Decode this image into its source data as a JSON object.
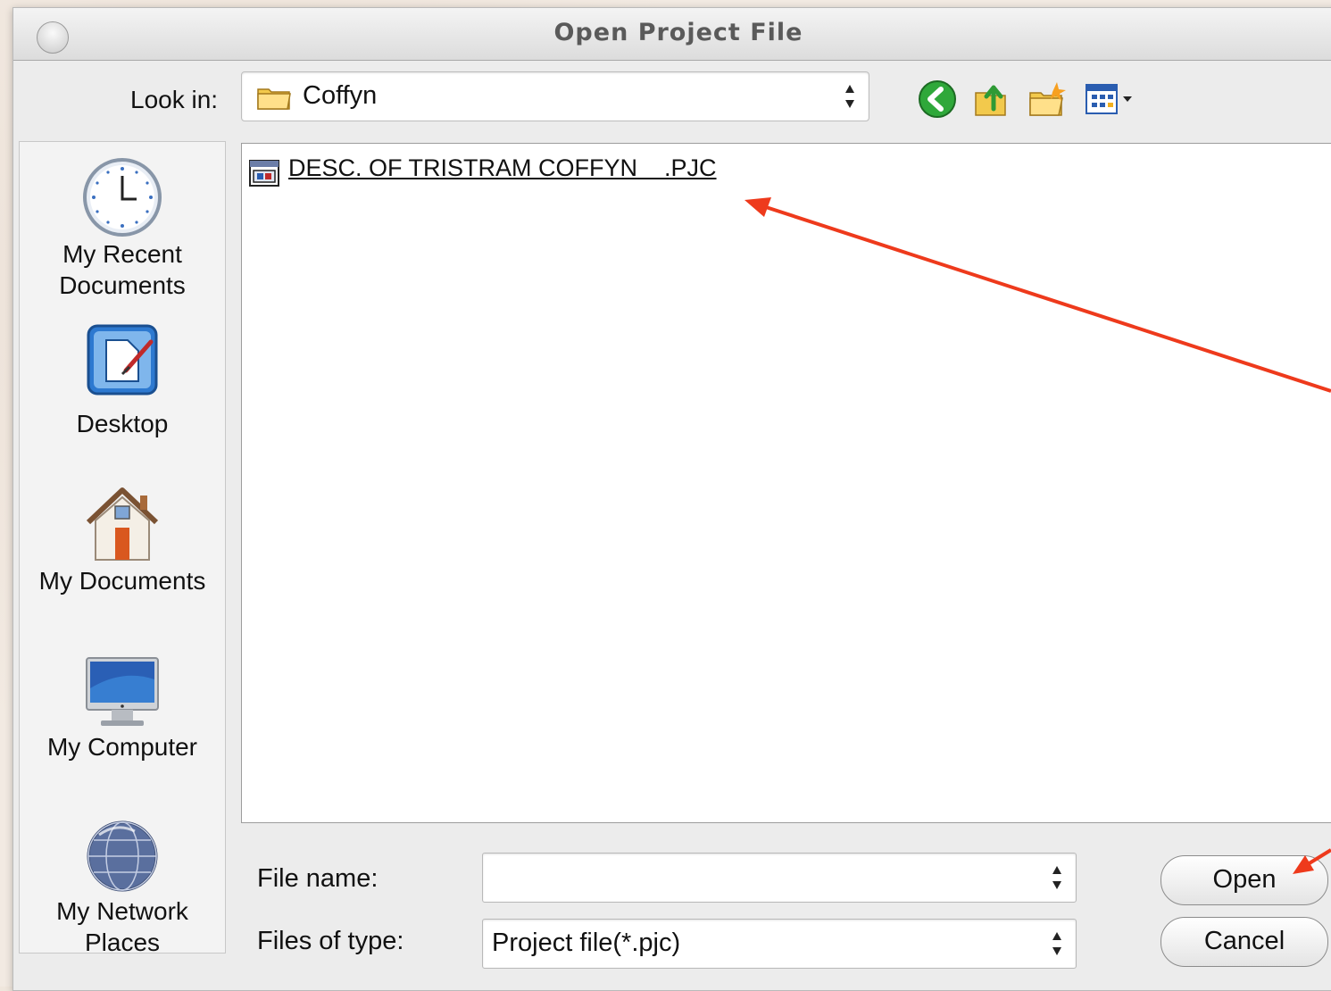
{
  "dialog": {
    "title": "Open Project File"
  },
  "look_in": {
    "label": "Look in:",
    "value": "Coffyn"
  },
  "toolbar": {
    "icons": [
      "back-icon",
      "up-folder-icon",
      "new-folder-icon",
      "view-menu-icon"
    ]
  },
  "places": [
    {
      "label": "My Recent Documents",
      "icon": "clock-icon"
    },
    {
      "label": "Desktop",
      "icon": "desktop-icon"
    },
    {
      "label": "My Documents",
      "icon": "house-icon"
    },
    {
      "label": "My Computer",
      "icon": "monitor-icon"
    },
    {
      "label": "My Network Places",
      "icon": "globe-icon"
    }
  ],
  "files": [
    {
      "name": "DESC. OF TRISTRAM COFFYN    .PJC",
      "icon": "project-file-icon"
    }
  ],
  "file_name": {
    "label": "File name:",
    "value": ""
  },
  "file_type": {
    "label": "Files of type:",
    "value": "Project file(*.pjc)"
  },
  "buttons": {
    "open": "Open",
    "cancel": "Cancel"
  },
  "annotation_color": "#ee3a1c"
}
